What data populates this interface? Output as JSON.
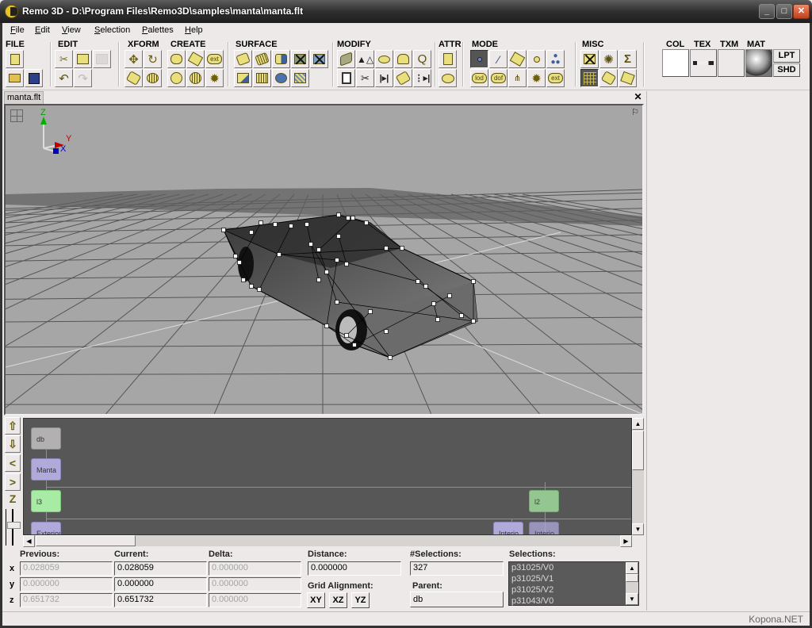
{
  "window": {
    "title": "Remo 3D - D:\\Program Files\\Remo3D\\samples\\manta\\manta.flt",
    "controls": {
      "minimize": "_",
      "maximize": "□",
      "close": "✕"
    }
  },
  "menu": [
    {
      "label": "File",
      "accel": "F"
    },
    {
      "label": "Edit",
      "accel": "E"
    },
    {
      "label": "View",
      "accel": "V"
    },
    {
      "label": "Selection",
      "accel": "S"
    },
    {
      "label": "Palettes",
      "accel": "P"
    },
    {
      "label": "Help",
      "accel": "H"
    }
  ],
  "toolbar": {
    "groups": [
      {
        "label": "FILE",
        "buttons": [
          "new-file-icon",
          "open-folder-icon",
          "save-disk-icon"
        ]
      },
      {
        "label": "EDIT",
        "buttons": [
          "cut-icon",
          "copy-icon",
          "paste-icon",
          "undo-icon",
          "redo-icon"
        ]
      },
      {
        "label": "XFORM",
        "buttons": [
          "move-icon",
          "rotate-icon",
          "put-icon",
          "scale-icon"
        ]
      },
      {
        "label": "CREATE",
        "buttons": [
          "create-group-icon",
          "create-object-icon",
          "create-ext-icon",
          "create-face-icon",
          "create-sphere-icon",
          "create-lightpoint-icon"
        ]
      },
      {
        "label": "SURFACE",
        "buttons": [
          "paint-color-icon",
          "paint-texture-icon",
          "paint-material-icon",
          "clear-color-icon",
          "clear-texture-icon",
          "pick-color-icon",
          "pick-texture-icon",
          "pick-material-icon",
          "texture-map-icon"
        ]
      },
      {
        "label": "MODIFY",
        "buttons": [
          "modify-face-icon",
          "flip-icon",
          "extrude-icon",
          "slice-icon",
          "find-icon",
          "split-icon",
          "merge-icon",
          "align-icon",
          "project-icon",
          "distribute-icon"
        ]
      },
      {
        "label": "ATTR",
        "buttons": [
          "attributes-icon",
          "comment-icon"
        ]
      },
      {
        "label": "MODE",
        "buttons": [
          "vertex-mode-icon",
          "edge-mode-icon",
          "face-mode-icon",
          "object-mode-icon",
          "group-mode-icon",
          "lod-mode-icon",
          "dof-mode-icon",
          "switch-mode-icon",
          "lightpoint-mode-icon",
          "ext-mode-icon"
        ]
      },
      {
        "label": "MISC",
        "buttons": [
          "bounding-box-icon",
          "explode-icon",
          "statistics-icon",
          "snap-grid-icon",
          "center-icon",
          "percentage-icon"
        ]
      }
    ],
    "create_labels": {
      "ext": "ext",
      "lod": "lod",
      "dof": "dof"
    },
    "material": {
      "labels": [
        "COL",
        "TEX",
        "TXM",
        "MAT"
      ],
      "lpt": "LPT",
      "shd": "SHD"
    }
  },
  "document_tab": {
    "label": "manta.flt",
    "close": "✕"
  },
  "viewport": {
    "axes": {
      "z": "Z",
      "y": "Y",
      "x": "X"
    },
    "colors": {
      "background": "#a6a6a6",
      "z_axis": "#00b000",
      "y_axis": "#c00000",
      "x_axis": "#0000c0"
    }
  },
  "hierarchy": {
    "nav": [
      "⇧",
      "⇩",
      "<",
      ">",
      "Z"
    ],
    "nodes": [
      {
        "label": "db",
        "type": "db"
      },
      {
        "label": "Manta",
        "type": "group"
      },
      {
        "label": "l3",
        "type": "lod"
      },
      {
        "label": "Exterior",
        "type": "group"
      },
      {
        "label": "l2",
        "type": "lod"
      },
      {
        "label": "Interio",
        "type": "group"
      },
      {
        "label": "Interio",
        "type": "group"
      }
    ]
  },
  "properties": {
    "headers": {
      "previous": "Previous:",
      "current": "Current:",
      "delta": "Delta:",
      "distance": "Distance:",
      "num_selections": "#Selections:",
      "selections": "Selections:",
      "grid_alignment": "Grid Alignment:",
      "parent": "Parent:"
    },
    "rows": [
      {
        "axis": "x",
        "previous": "0.028059",
        "current": "0.028059",
        "delta": "0.000000"
      },
      {
        "axis": "y",
        "previous": "0.000000",
        "current": "0.000000",
        "delta": "0.000000"
      },
      {
        "axis": "z",
        "previous": "0.651732",
        "current": "0.651732",
        "delta": "0.000000"
      }
    ],
    "distance": "0.000000",
    "num_selections": "327",
    "grid_buttons": [
      "XY",
      "XZ",
      "YZ"
    ],
    "parent": "db",
    "selections": [
      "p31025/V0",
      "p31025/V1",
      "p31025/V2",
      "p31043/V0"
    ]
  },
  "watermark": "Kopona.NET"
}
